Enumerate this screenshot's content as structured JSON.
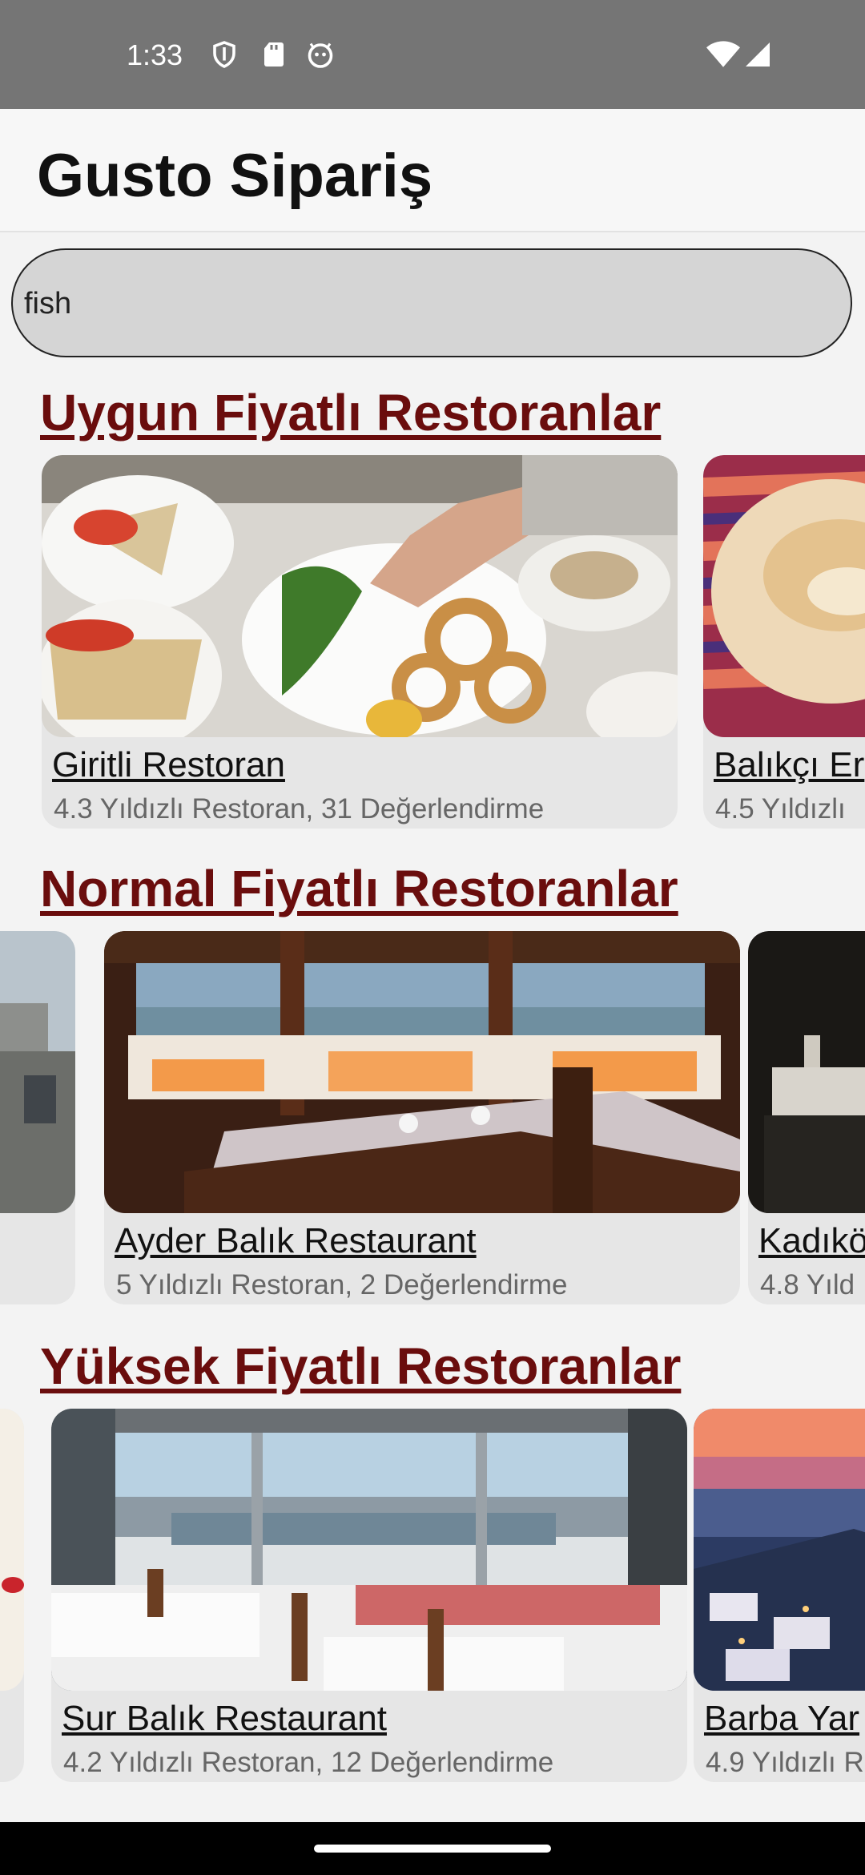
{
  "status_bar": {
    "time": "1:33"
  },
  "app_bar": {
    "title": "Gusto Sipariş"
  },
  "search": {
    "value": "fish"
  },
  "sections": [
    {
      "title": "Uygun Fiyatlı Restoranlar",
      "cards": [
        {
          "name": "Giritli Restoran",
          "meta": "4.3 Yıldızlı Restoran, 31 Değerlendirme"
        },
        {
          "name": "Balıkçı Er",
          "meta": "4.5 Yıldızlı"
        }
      ]
    },
    {
      "title": "Normal Fiyatlı Restoranlar",
      "cards": [
        {
          "name": "Ayder Balık Restaurant",
          "meta": "5 Yıldızlı Restoran, 2 Değerlendirme"
        },
        {
          "name": "Kadıkö",
          "meta": "4.8 Yıld"
        }
      ]
    },
    {
      "title": "Yüksek Fiyatlı Restoranlar",
      "cards": [
        {
          "name": "Sur Balık Restaurant",
          "meta": "4.2 Yıldızlı Restoran, 12 Değerlendirme"
        },
        {
          "name": "Barba Yar",
          "meta": "4.9 Yıldızlı R"
        }
      ]
    }
  ],
  "colors": {
    "section_title": "#6a0d0d",
    "status_bar": "#757575",
    "card_bg": "#e6e6e6"
  }
}
